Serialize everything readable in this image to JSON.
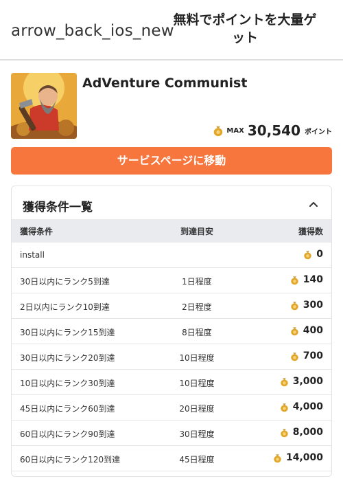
{
  "header": {
    "back_icon_text": "arrow_back_ios_new",
    "title": "無料でポイントを大量ゲット"
  },
  "app": {
    "name": "AdVenture Communist",
    "max_label": "MAX",
    "max_points": "30,540",
    "points_unit": "ポイント"
  },
  "cta": {
    "label": "サービスページに移動"
  },
  "conditions": {
    "title": "獲得条件一覧",
    "headers": {
      "condition": "獲得条件",
      "period": "到達目安",
      "points": "獲得数"
    },
    "rows": [
      {
        "condition": "install",
        "period": "",
        "points": "0"
      },
      {
        "condition": "30日以内にランク5到達",
        "period": "1日程度",
        "points": "140"
      },
      {
        "condition": "2日以内にランク10到達",
        "period": "2日程度",
        "points": "300"
      },
      {
        "condition": "30日以内にランク15到達",
        "period": "8日程度",
        "points": "400"
      },
      {
        "condition": "30日以内にランク20到達",
        "period": "10日程度",
        "points": "700"
      },
      {
        "condition": "10日以内にランク30到達",
        "period": "10日程度",
        "points": "3,000"
      },
      {
        "condition": "45日以内にランク60到達",
        "period": "20日程度",
        "points": "4,000"
      },
      {
        "condition": "60日以内にランク90到達",
        "period": "30日程度",
        "points": "8,000"
      },
      {
        "condition": "60日以内にランク120到達",
        "period": "45日程度",
        "points": "14,000"
      }
    ]
  },
  "colors": {
    "accent": "#f7763e",
    "table_header": "#e9ebef",
    "coin_bag": "#e2a72a"
  },
  "icons": {
    "back": "arrow-back-icon",
    "points": "money-bag-icon",
    "collapse": "chevron-up-icon"
  }
}
